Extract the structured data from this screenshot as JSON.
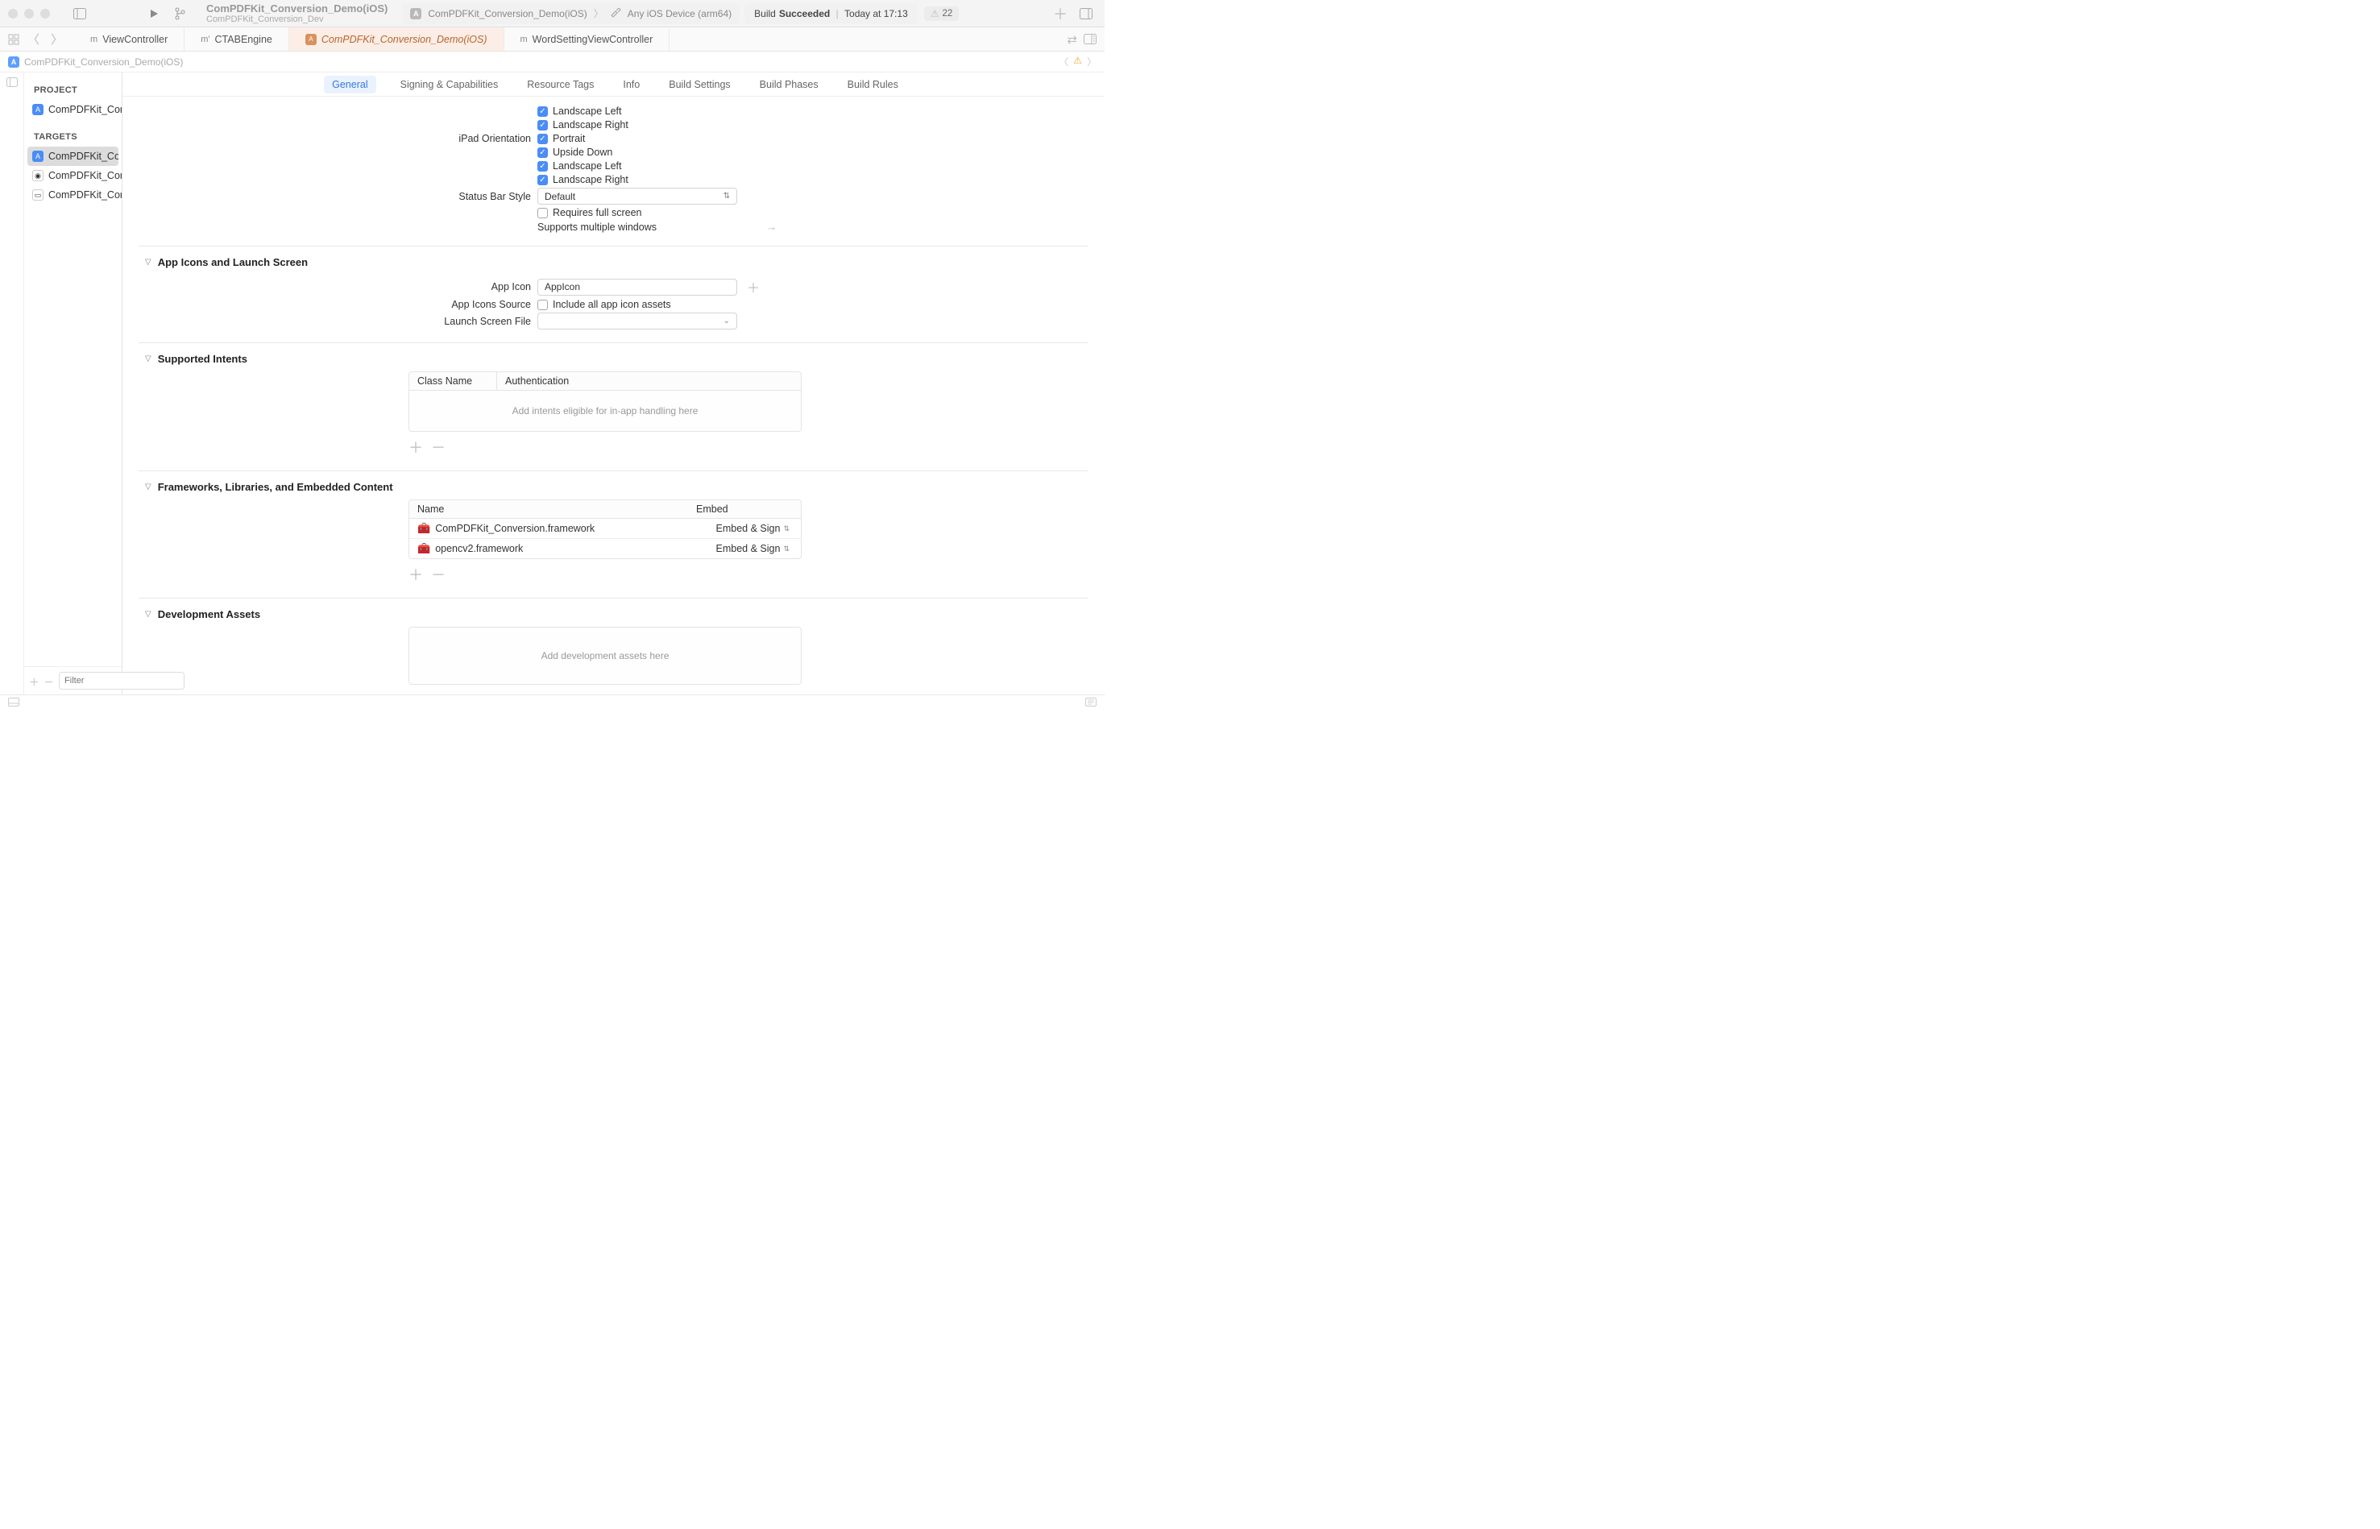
{
  "toolbar": {
    "scheme_title": "ComPDFKit_Conversion_Demo(iOS)",
    "scheme_subtitle": "ComPDFKit_Conversion_Dev",
    "jump_project": "ComPDFKit_Conversion_Demo(iOS)",
    "jump_device": "Any iOS Device (arm64)",
    "status_build_prefix": "Build ",
    "status_build_strong": "Succeeded",
    "status_time": "Today at 17:13",
    "warn_count": "22"
  },
  "tabs": {
    "t1": "ViewController",
    "t2": "CTABEngine",
    "t3": "ComPDFKit_Conversion_Demo(iOS)",
    "t4": "WordSettingViewController"
  },
  "jumpbar": {
    "project": "ComPDFKit_Conversion_Demo(iOS)"
  },
  "sidebar": {
    "section_project": "PROJECT",
    "section_targets": "TARGETS",
    "project_item": "ComPDFKit_Conver...",
    "target1": "ComPDFKit_Conver...",
    "target2": "ComPDFKit_Conver...",
    "target3": "ComPDFKit_Conver...",
    "filter_placeholder": "Filter"
  },
  "settings_tabs": {
    "general": "General",
    "signing": "Signing & Capabilities",
    "resource": "Resource Tags",
    "info": "Info",
    "build_settings": "Build Settings",
    "build_phases": "Build Phases",
    "build_rules": "Build Rules"
  },
  "orientation": {
    "landscape_left": "Landscape Left",
    "landscape_right": "Landscape Right",
    "ipad_label": "iPad Orientation",
    "portrait": "Portrait",
    "upside_down": "Upside Down",
    "landscape_left2": "Landscape Left",
    "landscape_right2": "Landscape Right"
  },
  "statusbar": {
    "label": "Status Bar Style",
    "default": "Default",
    "requires": "Requires full screen",
    "supports": "Supports multiple windows"
  },
  "appicons": {
    "section": "App Icons and Launch Screen",
    "appicon_label": "App Icon",
    "appicon_value": "AppIcon",
    "source_label": "App Icons Source",
    "include_all": "Include all app icon assets",
    "launch_label": "Launch Screen File"
  },
  "intents": {
    "section": "Supported Intents",
    "col_class": "Class Name",
    "col_auth": "Authentication",
    "empty": "Add intents eligible for in-app handling here"
  },
  "frameworks": {
    "section": "Frameworks, Libraries, and Embedded Content",
    "col_name": "Name",
    "col_embed": "Embed",
    "items": [
      {
        "name": "ComPDFKit_Conversion.framework",
        "embed": "Embed & Sign"
      },
      {
        "name": "opencv2.framework",
        "embed": "Embed & Sign"
      }
    ]
  },
  "devassets": {
    "section": "Development Assets",
    "empty": "Add development assets here"
  }
}
